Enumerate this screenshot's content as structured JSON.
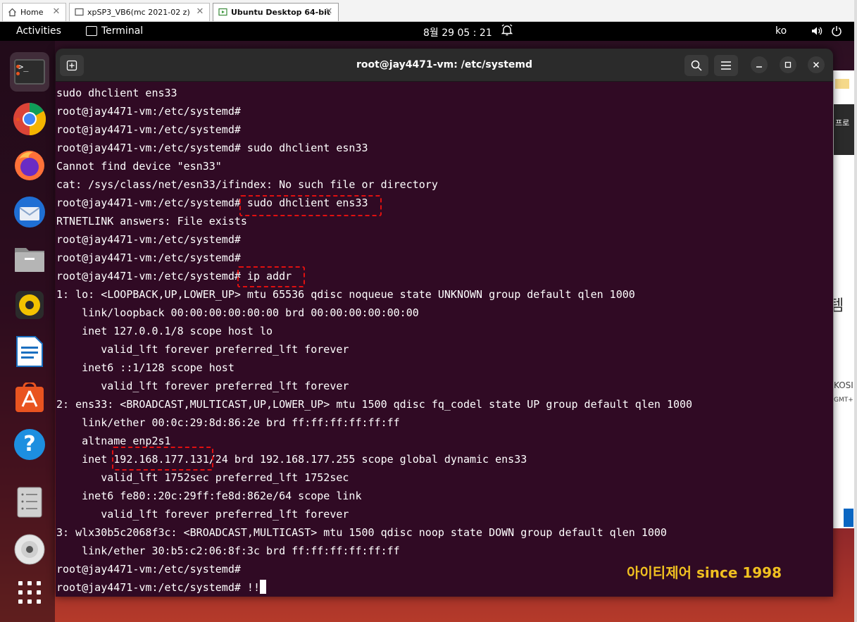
{
  "vmware": {
    "tabs": [
      {
        "label": "Home",
        "icon": "home-icon"
      },
      {
        "label": "xpSP3_VB6(mc 2021-02 z)",
        "icon": "vm-icon"
      },
      {
        "label": "Ubuntu Desktop 64-bit",
        "icon": "vm-running-icon"
      }
    ]
  },
  "top_bar": {
    "activities": "Activities",
    "app_name": "Terminal",
    "clock": "8월 29  05 : 21",
    "input_method": "ko"
  },
  "dock": {
    "items": [
      {
        "name": "terminal",
        "icon": "terminal-icon",
        "label": ">_"
      },
      {
        "name": "chrome",
        "icon": "chrome-icon"
      },
      {
        "name": "firefox",
        "icon": "firefox-icon"
      },
      {
        "name": "thunderbird",
        "icon": "thunderbird-icon"
      },
      {
        "name": "files",
        "icon": "files-icon"
      },
      {
        "name": "rhythmbox",
        "icon": "rhythmbox-icon"
      },
      {
        "name": "writer",
        "icon": "libreoffice-writer-icon"
      },
      {
        "name": "app-center",
        "icon": "app-center-icon"
      },
      {
        "name": "help",
        "icon": "help-icon",
        "label": "?"
      },
      {
        "name": "server",
        "icon": "server-icon"
      },
      {
        "name": "disc",
        "icon": "disc-icon"
      },
      {
        "name": "show-apps",
        "icon": "grid-icon"
      }
    ]
  },
  "background_window": {
    "fragments": [
      "프로",
      "템",
      "KOSI",
      "GMT+"
    ]
  },
  "terminal": {
    "title": "root@jay4471-vm: /etc/systemd",
    "lines": [
      "sudo dhclient ens33",
      "root@jay4471-vm:/etc/systemd#",
      "root@jay4471-vm:/etc/systemd#",
      "root@jay4471-vm:/etc/systemd# sudo dhclient esn33",
      "Cannot find device \"esn33\"",
      "cat: /sys/class/net/esn33/ifindex: No such file or directory",
      "root@jay4471-vm:/etc/systemd# sudo dhclient ens33",
      "RTNETLINK answers: File exists",
      "root@jay4471-vm:/etc/systemd#",
      "root@jay4471-vm:/etc/systemd#",
      "root@jay4471-vm:/etc/systemd# ip addr",
      "1: lo: <LOOPBACK,UP,LOWER_UP> mtu 65536 qdisc noqueue state UNKNOWN group default qlen 1000",
      "    link/loopback 00:00:00:00:00:00 brd 00:00:00:00:00:00",
      "    inet 127.0.0.1/8 scope host lo",
      "       valid_lft forever preferred_lft forever",
      "    inet6 ::1/128 scope host",
      "       valid_lft forever preferred_lft forever",
      "2: ens33: <BROADCAST,MULTICAST,UP,LOWER_UP> mtu 1500 qdisc fq_codel state UP group default qlen 1000",
      "    link/ether 00:0c:29:8d:86:2e brd ff:ff:ff:ff:ff:ff",
      "    altname enp2s1",
      "    inet 192.168.177.131/24 brd 192.168.177.255 scope global dynamic ens33",
      "       valid_lft 1752sec preferred_lft 1752sec",
      "    inet6 fe80::20c:29ff:fe8d:862e/64 scope link",
      "       valid_lft forever preferred_lft forever",
      "3: wlx30b5c2068f3c: <BROADCAST,MULTICAST> mtu 1500 qdisc noop state DOWN group default qlen 1000",
      "    link/ether 30:b5:c2:06:8f:3c brd ff:ff:ff:ff:ff:ff",
      "root@jay4471-vm:/etc/systemd#"
    ],
    "current_prompt": "root@jay4471-vm:/etc/systemd# !!"
  },
  "watermark": "아이티제어 since 1998",
  "colors": {
    "terminal_bg": "#300a24",
    "highlight": "#e01010",
    "watermark": "#f0c020"
  }
}
